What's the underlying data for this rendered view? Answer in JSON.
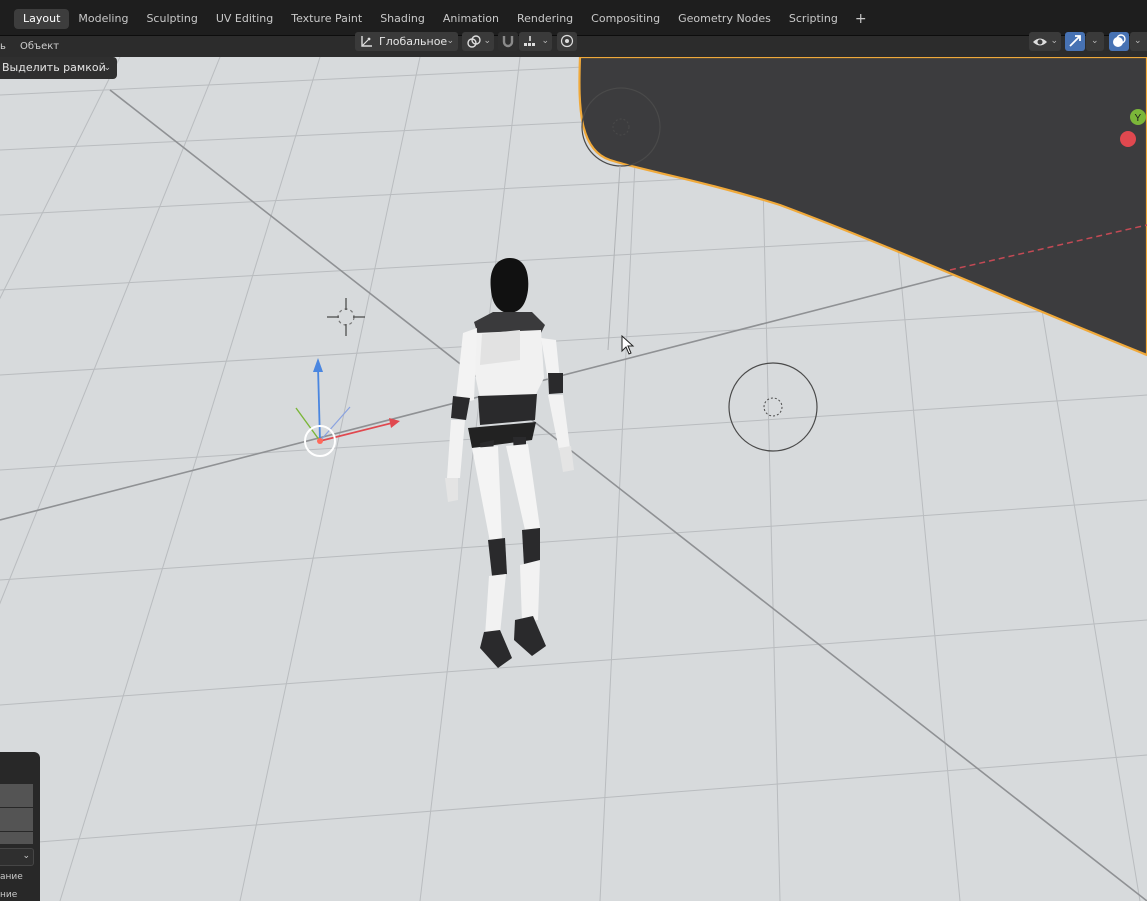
{
  "workspace_tabs": [
    {
      "label": "Layout",
      "active": true
    },
    {
      "label": "Modeling"
    },
    {
      "label": "Sculpting"
    },
    {
      "label": "UV Editing"
    },
    {
      "label": "Texture Paint"
    },
    {
      "label": "Shading"
    },
    {
      "label": "Animation"
    },
    {
      "label": "Rendering"
    },
    {
      "label": "Compositing"
    },
    {
      "label": "Geometry Nodes"
    },
    {
      "label": "Scripting"
    }
  ],
  "add_tab_label": "+",
  "header": {
    "menu_partial": "ь",
    "menu_object": "Объект",
    "transform_orientation": "Глобальное"
  },
  "tool_settings": {
    "select_mode": "Выделить рамкой"
  },
  "navigation_gizmo": {
    "y_axis_label": "Y"
  },
  "bottom_panel": {
    "text_1": "ание",
    "text_2": "ние"
  },
  "icons": {
    "workspace_add": "plus-icon",
    "orientation": "transform-orientation-icon",
    "pivot": "link-icon",
    "snap": "magnet-icon",
    "snap_target": "snap-increment-icon",
    "proportional": "proportional-edit-icon",
    "visibility": "eye-icon",
    "gizmo": "gizmo-arrow-icon",
    "overlays": "overlay-icon",
    "cursor": "mouse-pointer-icon"
  },
  "colors": {
    "active_tab": "#3d3d3d",
    "toggle_active": "#4772b3",
    "selection_outline": "#f0a93a",
    "axis_x": "#e0484f",
    "axis_y": "#7bb639",
    "axis_z": "#4a86e0"
  }
}
